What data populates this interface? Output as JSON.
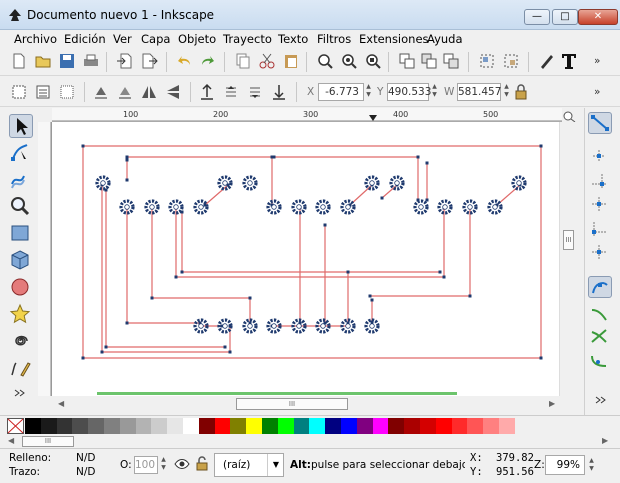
{
  "window": {
    "title": "Documento nuevo 1 - Inkscape",
    "minimize": "—",
    "maximize": "□",
    "close": "✕"
  },
  "menu": [
    "Archivo",
    "Edición",
    "Ver",
    "Capa",
    "Objeto",
    "Trayecto",
    "Texto",
    "Filtros",
    "Extensiones",
    "Ayuda"
  ],
  "toolbar": {
    "more": "»"
  },
  "controls": {
    "x_label": "X",
    "x_value": "-6.773",
    "y_label": "Y",
    "y_value": "490.533",
    "w_label": "W",
    "w_value": "581.457",
    "more": "»"
  },
  "ruler": {
    "ticks": [
      "100",
      "200",
      "300",
      "400",
      "500"
    ]
  },
  "scroll": {
    "grip": "III"
  },
  "palette": {
    "colors": [
      "#000000",
      "#1a1a1a",
      "#333333",
      "#4d4d4d",
      "#666666",
      "#808080",
      "#999999",
      "#b3b3b3",
      "#cccccc",
      "#e6e6e6",
      "#ffffff",
      "#800000",
      "#ff0000",
      "#808000",
      "#ffff00",
      "#008000",
      "#00ff00",
      "#008080",
      "#00ffff",
      "#000080",
      "#0000ff",
      "#800080",
      "#ff00ff",
      "#800000",
      "#aa0000",
      "#d40000",
      "#ff0000",
      "#ff2a2a",
      "#ff5555",
      "#ff8080",
      "#ffaaaa"
    ]
  },
  "status": {
    "fill_label": "Relleno:",
    "fill_value": "N/D",
    "stroke_label": "Trazo:",
    "stroke_value": "N/D",
    "opacity_label": "O:",
    "opacity_value": "100",
    "layer": "(raíz)",
    "message_bold": "Alt:",
    "message": "pulse para seleccionar debajo, arr",
    "x_label": "X:",
    "x_value": "379.82",
    "y_label": "Y:",
    "y_value": "951.56",
    "zoom_label": "Z:",
    "zoom_value": "99%"
  },
  "colors": {
    "accent": "#1a6fc9",
    "trace": "#e06a6a",
    "pad": "#1f3a6e"
  }
}
